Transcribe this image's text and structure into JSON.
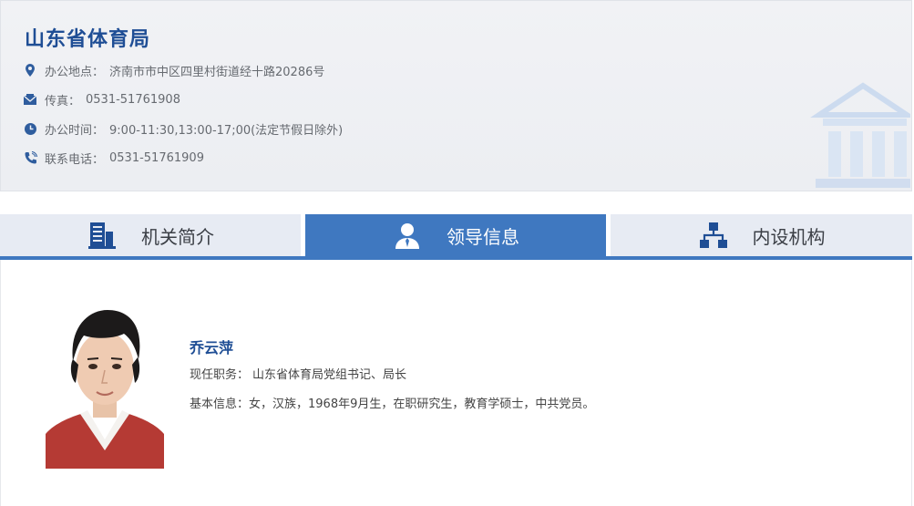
{
  "org": {
    "title": "山东省体育局",
    "address_label": "办公地点：",
    "address": "济南市市中区四里村街道经十路20286号",
    "fax_label": "传真：",
    "fax": "0531-51761908",
    "hours_label": "办公时间：",
    "hours": "9:00-11:30,13:00-17;00(法定节假日除外)",
    "phone_label": "联系电话：",
    "phone": "0531-51761909"
  },
  "tabs": [
    {
      "label": "机关简介",
      "icon": "building-icon"
    },
    {
      "label": "领导信息",
      "icon": "person-icon"
    },
    {
      "label": "内设机构",
      "icon": "org-chart-icon"
    }
  ],
  "leader": {
    "name": "乔云萍",
    "position_label": "现任职务：",
    "position": "山东省体育局党组书记、局长",
    "info_label": "基本信息：",
    "info": "女，汉族，1968年9月生，在职研究生，教育学硕士，中共党员。"
  },
  "colors": {
    "accent": "#3f78c0",
    "title": "#1f4e95",
    "tab_bg": "#e7ebf3"
  }
}
